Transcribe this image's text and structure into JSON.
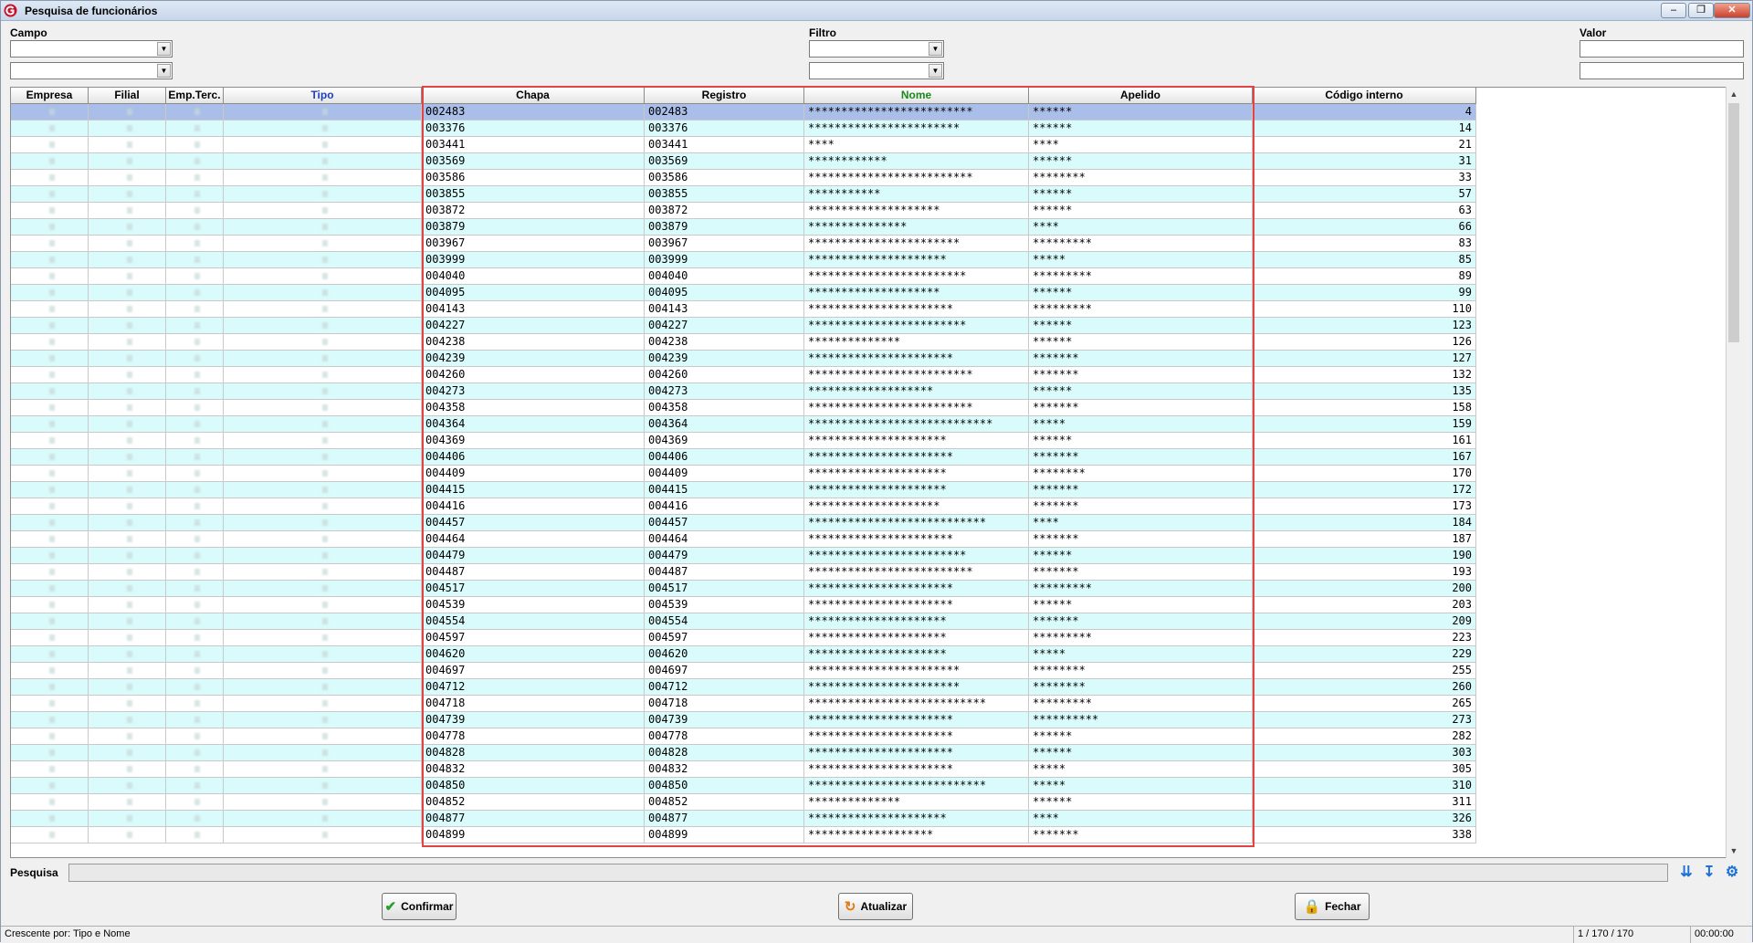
{
  "window": {
    "title": "Pesquisa de funcionários"
  },
  "filters": {
    "campo_label": "Campo",
    "filtro_label": "Filtro",
    "valor_label": "Valor"
  },
  "columns": [
    {
      "label": "Empresa",
      "color": "#000000"
    },
    {
      "label": "Filial",
      "color": "#000000"
    },
    {
      "label": "Emp.Terc.",
      "color": "#000000"
    },
    {
      "label": "Tipo",
      "color": "#1f3fbf"
    },
    {
      "label": "Chapa",
      "color": "#000000"
    },
    {
      "label": "Registro",
      "color": "#000000"
    },
    {
      "label": "Nome",
      "color": "#1a8a1a"
    },
    {
      "label": "Apelido",
      "color": "#000000"
    },
    {
      "label": "Código interno",
      "color": "#000000"
    }
  ],
  "rows": [
    [
      "002483",
      "002483",
      "*************************",
      "******",
      "4"
    ],
    [
      "003376",
      "003376",
      "***********************",
      "******",
      "14"
    ],
    [
      "003441",
      "003441",
      "****",
      "****",
      "21"
    ],
    [
      "003569",
      "003569",
      "************",
      "******",
      "31"
    ],
    [
      "003586",
      "003586",
      "*************************",
      "********",
      "33"
    ],
    [
      "003855",
      "003855",
      "***********",
      "******",
      "57"
    ],
    [
      "003872",
      "003872",
      "********************",
      "******",
      "63"
    ],
    [
      "003879",
      "003879",
      "***************",
      "****",
      "66"
    ],
    [
      "003967",
      "003967",
      "***********************",
      "*********",
      "83"
    ],
    [
      "003999",
      "003999",
      "*********************",
      "*****",
      "85"
    ],
    [
      "004040",
      "004040",
      "************************",
      "*********",
      "89"
    ],
    [
      "004095",
      "004095",
      "********************",
      "******",
      "99"
    ],
    [
      "004143",
      "004143",
      "**********************",
      "*********",
      "110"
    ],
    [
      "004227",
      "004227",
      "************************",
      "******",
      "123"
    ],
    [
      "004238",
      "004238",
      "**************",
      "******",
      "126"
    ],
    [
      "004239",
      "004239",
      "**********************",
      "*******",
      "127"
    ],
    [
      "004260",
      "004260",
      "*************************",
      "*******",
      "132"
    ],
    [
      "004273",
      "004273",
      "*******************",
      "******",
      "135"
    ],
    [
      "004358",
      "004358",
      "*************************",
      "*******",
      "158"
    ],
    [
      "004364",
      "004364",
      "****************************",
      "*****",
      "159"
    ],
    [
      "004369",
      "004369",
      "*********************",
      "******",
      "161"
    ],
    [
      "004406",
      "004406",
      "**********************",
      "*******",
      "167"
    ],
    [
      "004409",
      "004409",
      "*********************",
      "********",
      "170"
    ],
    [
      "004415",
      "004415",
      "*********************",
      "*******",
      "172"
    ],
    [
      "004416",
      "004416",
      "********************",
      "*******",
      "173"
    ],
    [
      "004457",
      "004457",
      "***************************",
      "****",
      "184"
    ],
    [
      "004464",
      "004464",
      "**********************",
      "*******",
      "187"
    ],
    [
      "004479",
      "004479",
      "************************",
      "******",
      "190"
    ],
    [
      "004487",
      "004487",
      "*************************",
      "*******",
      "193"
    ],
    [
      "004517",
      "004517",
      "**********************",
      "*********",
      "200"
    ],
    [
      "004539",
      "004539",
      "**********************",
      "******",
      "203"
    ],
    [
      "004554",
      "004554",
      "*********************",
      "*******",
      "209"
    ],
    [
      "004597",
      "004597",
      "*********************",
      "*********",
      "223"
    ],
    [
      "004620",
      "004620",
      "*********************",
      "*****",
      "229"
    ],
    [
      "004697",
      "004697",
      "***********************",
      "********",
      "255"
    ],
    [
      "004712",
      "004712",
      "***********************",
      "********",
      "260"
    ],
    [
      "004718",
      "004718",
      "***************************",
      "*********",
      "265"
    ],
    [
      "004739",
      "004739",
      "**********************",
      "**********",
      "273"
    ],
    [
      "004778",
      "004778",
      "**********************",
      "******",
      "282"
    ],
    [
      "004828",
      "004828",
      "**********************",
      "******",
      "303"
    ],
    [
      "004832",
      "004832",
      "**********************",
      "*****",
      "305"
    ],
    [
      "004850",
      "004850",
      "***************************",
      "*****",
      "310"
    ],
    [
      "004852",
      "004852",
      "**************",
      "******",
      "311"
    ],
    [
      "004877",
      "004877",
      "*********************",
      "****",
      "326"
    ],
    [
      "004899",
      "004899",
      "*******************",
      "*******",
      "338"
    ]
  ],
  "search": {
    "label": "Pesquisa",
    "value": ""
  },
  "buttons": {
    "confirm": "Confirmar",
    "refresh": "Atualizar",
    "close": "Fechar"
  },
  "status": {
    "sort": "Crescente por: Tipo e Nome",
    "position": "1 / 170 / 170",
    "time": "00:00:00"
  },
  "icons": {
    "app": "app-logo-icon",
    "confirm": "check-icon",
    "refresh": "refresh-icon",
    "close": "lock-icon",
    "expand": "double-chevron-down-icon",
    "last": "chevron-down-end-icon",
    "settings": "gear-icon"
  }
}
